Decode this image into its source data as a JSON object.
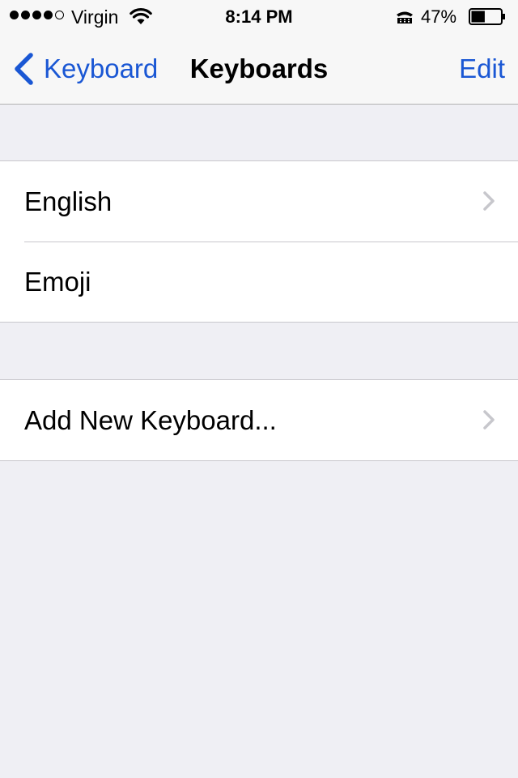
{
  "status_bar": {
    "carrier": "Virgin",
    "signal_bars_filled": 4,
    "signal_bars_total": 5,
    "time": "8:14 PM",
    "battery_percent": "47%",
    "battery_level": 0.47,
    "icons": [
      "wifi-icon",
      "tty-icon",
      "battery-icon"
    ]
  },
  "nav": {
    "back_label": "Keyboard",
    "title": "Keyboards",
    "edit_label": "Edit"
  },
  "sections": [
    {
      "rows": [
        {
          "label": "English",
          "has_disclosure": true
        },
        {
          "label": "Emoji",
          "has_disclosure": false
        }
      ]
    },
    {
      "rows": [
        {
          "label": "Add New Keyboard...",
          "has_disclosure": true
        }
      ]
    }
  ],
  "colors": {
    "accent": "#1a57d4",
    "background": "#efeff4",
    "bar_background": "#f7f7f7",
    "separator": "#c8c7cc",
    "disclosure": "#c7c7cc"
  }
}
